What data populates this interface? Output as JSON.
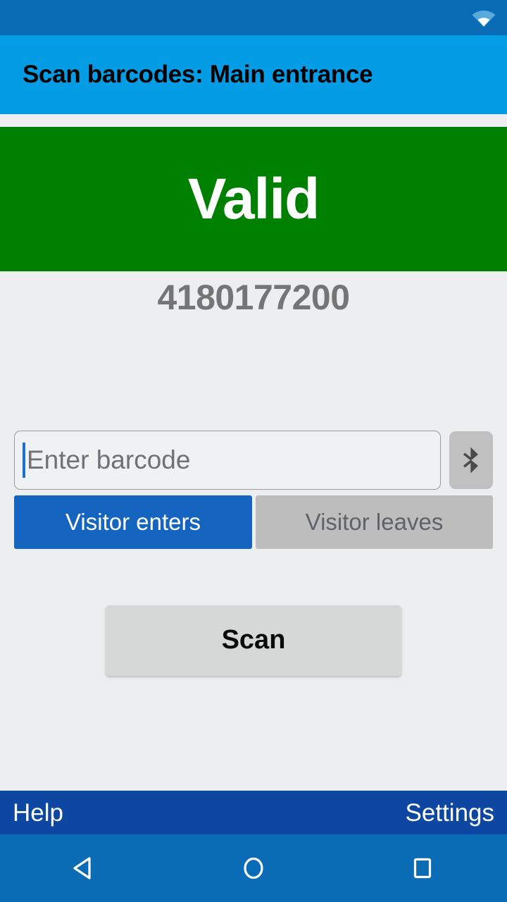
{
  "status_bar": {
    "wifi_icon": "wifi-icon"
  },
  "action_bar": {
    "title": "Scan barcodes: Main entrance"
  },
  "scan_result": {
    "status_text": "Valid",
    "status_color": "#008000",
    "barcode_value": "4180177200"
  },
  "input": {
    "placeholder": "Enter barcode",
    "value": "",
    "bluetooth_icon": "bluetooth-icon"
  },
  "direction_toggle": {
    "options": [
      {
        "label": "Visitor enters",
        "selected": true
      },
      {
        "label": "Visitor leaves",
        "selected": false
      }
    ],
    "selected_color": "#1565c0",
    "unselected_color": "#bdbdbd"
  },
  "actions": {
    "scan_label": "Scan"
  },
  "bottom_bar": {
    "help_label": "Help",
    "settings_label": "Settings",
    "background_color": "#0d47a1"
  },
  "nav_bar": {
    "back_icon": "back-triangle-icon",
    "home_icon": "home-circle-icon",
    "recents_icon": "recents-square-icon",
    "background_color": "#0a6cb4"
  }
}
